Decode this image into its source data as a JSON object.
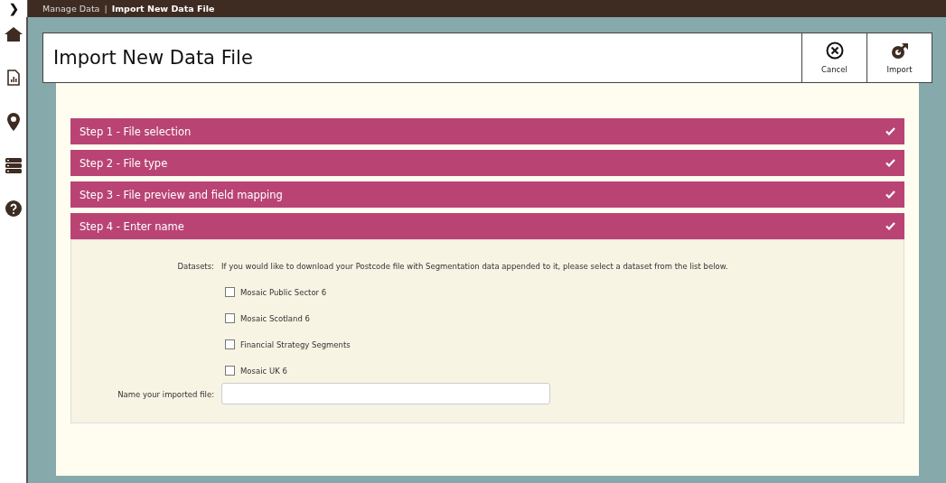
{
  "breadcrumb": {
    "parent": "Manage Data",
    "separator": "|",
    "current": "Import New Data File"
  },
  "sidebar": {
    "toggle": "❯"
  },
  "header": {
    "title": "Import New Data File",
    "actions": [
      {
        "label": "Cancel",
        "kind": "cancel"
      },
      {
        "label": "Import",
        "kind": "import"
      }
    ]
  },
  "steps": [
    {
      "title": "Step 1 - File selection",
      "done": true,
      "expanded": false
    },
    {
      "title": "Step 2 - File type",
      "done": true,
      "expanded": false
    },
    {
      "title": "Step 3 - File preview and field mapping",
      "done": true,
      "expanded": false
    },
    {
      "title": "Step 4 - Enter name",
      "done": true,
      "expanded": true
    }
  ],
  "form": {
    "datasets_label": "Datasets:",
    "datasets_hint": "If you would like to download your Postcode file with Segmentation data appended to it, please select a dataset from the list below.",
    "datasets": [
      {
        "label": "Mosaic Public Sector 6",
        "checked": false
      },
      {
        "label": "Mosaic Scotland 6",
        "checked": false
      },
      {
        "label": "Financial Strategy Segments",
        "checked": false
      },
      {
        "label": "Mosaic UK 6",
        "checked": false
      }
    ],
    "name_label": "Name your imported file:"
  }
}
